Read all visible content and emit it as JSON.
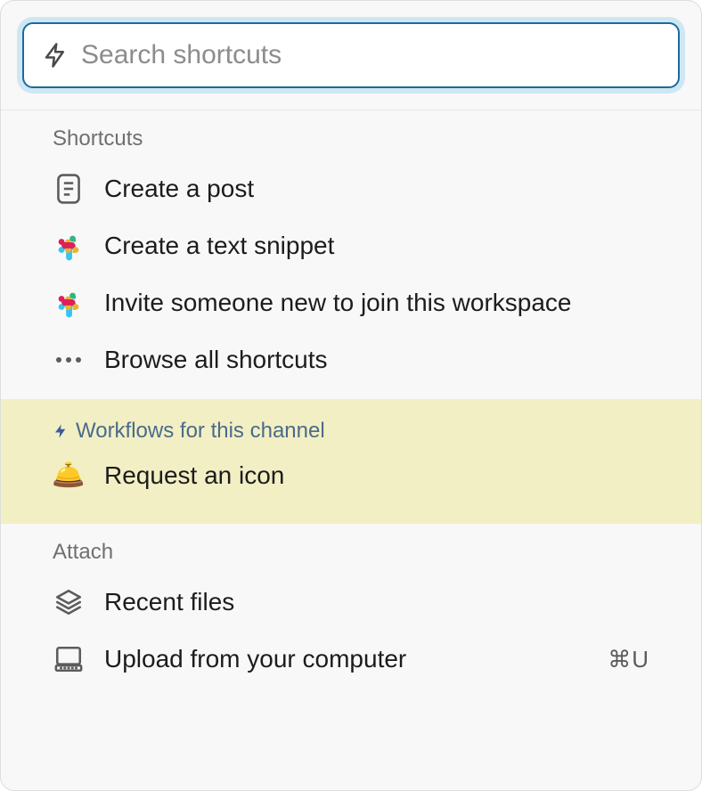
{
  "search": {
    "placeholder": "Search shortcuts"
  },
  "sections": {
    "shortcuts": {
      "header": "Shortcuts",
      "items": [
        {
          "label": "Create a post"
        },
        {
          "label": "Create a text snippet"
        },
        {
          "label": "Invite someone new to join this workspace"
        },
        {
          "label": "Browse all shortcuts"
        }
      ]
    },
    "workflows": {
      "header": "Workflows for this channel",
      "items": [
        {
          "label": "Request an icon"
        }
      ]
    },
    "attach": {
      "header": "Attach",
      "items": [
        {
          "label": "Recent files"
        },
        {
          "label": "Upload from your computer",
          "shortcut": "⌘U"
        }
      ]
    }
  }
}
